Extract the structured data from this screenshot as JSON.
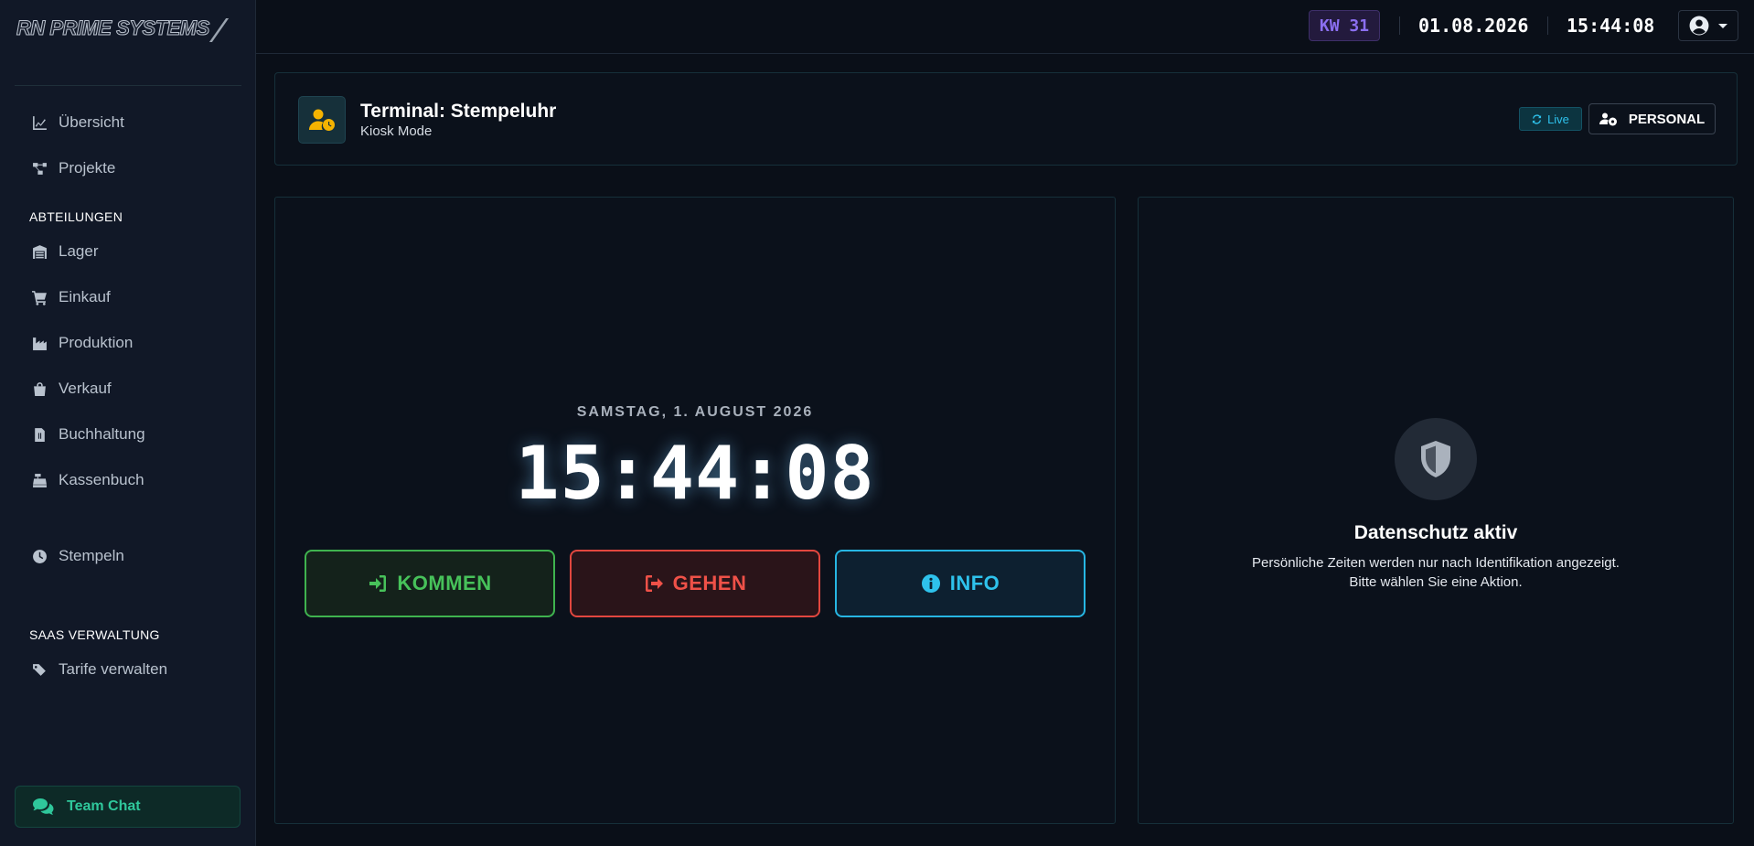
{
  "brand": {
    "logo_text": "RN PRIME SYSTEMS"
  },
  "sidebar": {
    "items": [
      {
        "label": "Übersicht",
        "icon": "chart-line-icon"
      },
      {
        "label": "Projekte",
        "icon": "project-diagram-icon"
      }
    ],
    "section_abteilungen": "ABTEILUNGEN",
    "departments": [
      {
        "label": "Lager",
        "icon": "warehouse-icon"
      },
      {
        "label": "Einkauf",
        "icon": "shopping-cart-icon"
      },
      {
        "label": "Produktion",
        "icon": "industry-icon"
      },
      {
        "label": "Verkauf",
        "icon": "shopping-bag-icon"
      },
      {
        "label": "Buchhaltung",
        "icon": "file-invoice-dollar-icon"
      },
      {
        "label": "Kassenbuch",
        "icon": "cash-register-icon"
      }
    ],
    "stempeln": {
      "label": "Stempeln",
      "icon": "clock-icon"
    },
    "section_saas": "SAAS VERWALTUNG",
    "saas_items": [
      {
        "label": "Tarife verwalten",
        "icon": "tags-icon"
      }
    ],
    "team_chat": {
      "label": "Team Chat",
      "icon": "comments-icon"
    }
  },
  "topbar": {
    "week_badge": "KW 31",
    "date": "01.08.2026",
    "time": "15:44:08",
    "user_icon": "user-circle-icon"
  },
  "header": {
    "icon": "user-clock-icon",
    "title": "Terminal: Stempeluhr",
    "subtitle": "Kiosk Mode",
    "live_badge": "Live",
    "personal_button": "PERSONAL"
  },
  "clock": {
    "date_line": "SAMSTAG, 1. AUGUST 2026",
    "time": "15:44:08",
    "buttons": {
      "kommen": "KOMMEN",
      "gehen": "GEHEN",
      "info": "INFO"
    }
  },
  "privacy": {
    "icon": "shield-icon",
    "title": "Datenschutz aktiv",
    "line1": "Persönliche Zeiten werden nur nach Identifikation angezeigt.",
    "line2": "Bitte wählen Sie eine Aktion."
  },
  "colors": {
    "accent_green": "#47c25a",
    "accent_red": "#ef5148",
    "accent_cyan": "#2ec2ec",
    "accent_purple": "#8b6ff0",
    "chat_green": "#2fc79b",
    "icon_yellow": "#f5b301"
  }
}
